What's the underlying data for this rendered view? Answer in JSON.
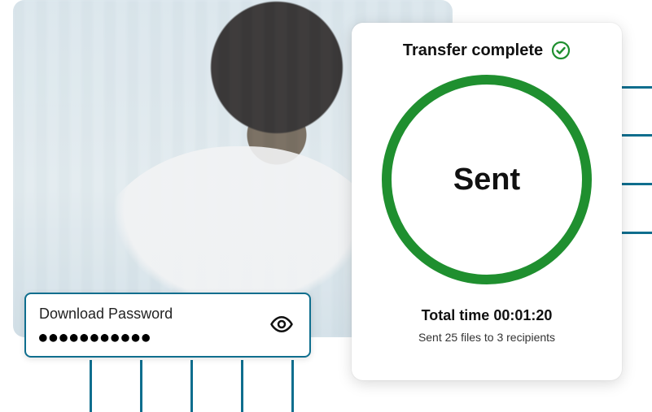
{
  "transfer": {
    "title": "Transfer complete",
    "ring_label": "Sent",
    "total_time_label": "Total time",
    "total_time_value": "00:01:20",
    "summary": "Sent 25 files to 3 recipients"
  },
  "password": {
    "label": "Download Password",
    "masked_value": "●●●●●●●●●●●"
  },
  "colors": {
    "accent_teal": "#0f6e8e",
    "success_green": "#1f8f2f"
  }
}
